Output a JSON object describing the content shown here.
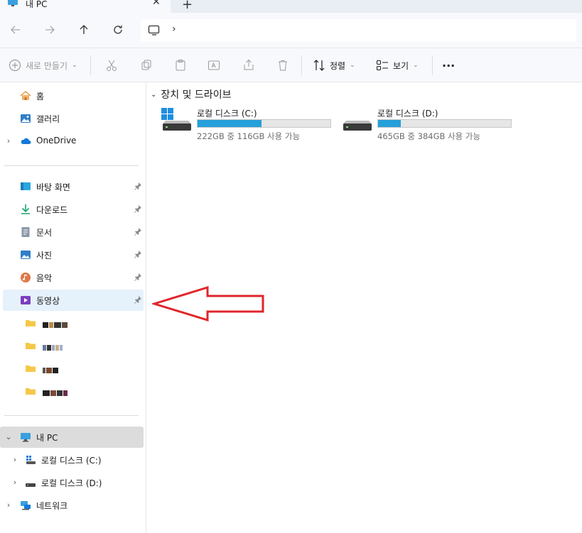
{
  "tab": {
    "title": "내 PC",
    "close": "✕",
    "new": "+"
  },
  "nav": {
    "back": "back",
    "forward": "forward",
    "up": "up",
    "refresh": "refresh",
    "breadcrumb_sep": "›"
  },
  "command_bar": {
    "new_label": "새로 만들기",
    "sort_label": "정렬",
    "view_label": "보기",
    "more": "···"
  },
  "sidebar": {
    "home": "홈",
    "gallery": "갤러리",
    "onedrive": "OneDrive",
    "quick": [
      {
        "label": "바탕 화면",
        "icon": "desktop-icon"
      },
      {
        "label": "다운로드",
        "icon": "download-icon"
      },
      {
        "label": "문서",
        "icon": "documents-icon"
      },
      {
        "label": "사진",
        "icon": "pictures-icon"
      },
      {
        "label": "음악",
        "icon": "music-icon"
      },
      {
        "label": "동영상",
        "icon": "videos-icon"
      }
    ],
    "this_pc": "내 PC",
    "drive_c": "로컬 디스크 (C:)",
    "drive_d": "로컬 디스크 (D:)",
    "network": "네트워크"
  },
  "main": {
    "group_title": "장치 및 드라이브",
    "drives": [
      {
        "name": "로컬 디스크 (C:)",
        "info": "222GB 중 116GB 사용 가능",
        "used_fraction": 0.48
      },
      {
        "name": "로컬 디스크 (D:)",
        "info": "465GB 중 384GB 사용 가능",
        "used_fraction": 0.17
      }
    ]
  },
  "colors": {
    "accent": "#26a0da",
    "annotation": "#e0262b",
    "selection": "#e5f1fb"
  }
}
